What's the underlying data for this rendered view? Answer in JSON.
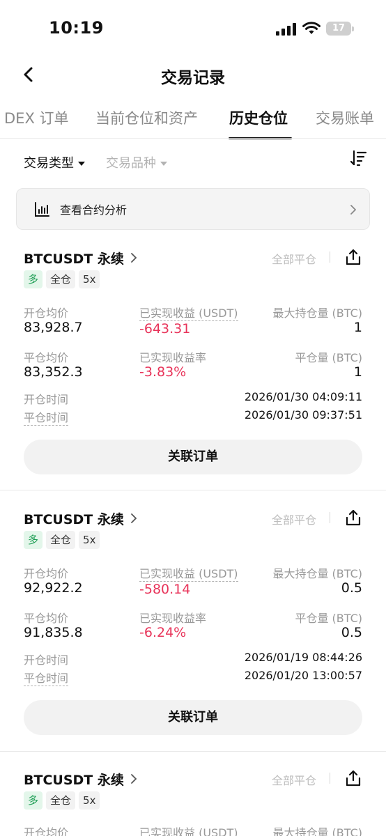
{
  "status_bar": {
    "time": "10:19",
    "battery": "17"
  },
  "header": {
    "title": "交易记录"
  },
  "tabs": [
    {
      "label": "DEX 订单"
    },
    {
      "label": "当前仓位和资产"
    },
    {
      "label": "历史仓位"
    },
    {
      "label": "交易账单"
    }
  ],
  "filters": {
    "trade_type": "交易类型",
    "instrument": "交易品种"
  },
  "analysis": {
    "label": "查看合约分析"
  },
  "labels": {
    "close_all": "全部平仓",
    "open_avg": "开仓均价",
    "realized_pnl": "已实现收益 (USDT)",
    "max_position": "最大持仓量 (BTC)",
    "close_avg": "平仓均价",
    "realized_pnl_rate": "已实现收益率",
    "closed_amount": "平仓量 (BTC)",
    "open_time": "开仓时间",
    "close_time": "平仓时间",
    "related_orders": "关联订单"
  },
  "positions": [
    {
      "symbol": "BTCUSDT 永续",
      "tags": [
        "多",
        "全仓",
        "5x"
      ],
      "open_avg": "83,928.7",
      "realized_pnl": "-643.31",
      "max_position": "1",
      "close_avg": "83,352.3",
      "realized_pnl_rate": "-3.83%",
      "closed_amount": "1",
      "open_time": "2026/01/30 04:09:11",
      "close_time": "2026/01/30 09:37:51"
    },
    {
      "symbol": "BTCUSDT 永续",
      "tags": [
        "多",
        "全仓",
        "5x"
      ],
      "open_avg": "92,922.2",
      "realized_pnl": "-580.14",
      "max_position": "0.5",
      "close_avg": "91,835.8",
      "realized_pnl_rate": "-6.24%",
      "closed_amount": "0.5",
      "open_time": "2026/01/19 08:44:26",
      "close_time": "2026/01/20 13:00:57"
    },
    {
      "symbol": "BTCUSDT 永续",
      "tags": [
        "多",
        "全仓",
        "5x"
      ]
    }
  ],
  "colors": {
    "negative": "#e8345a",
    "long_tag": "#1f9e55",
    "long_tag_bg": "#e3f6ea"
  }
}
